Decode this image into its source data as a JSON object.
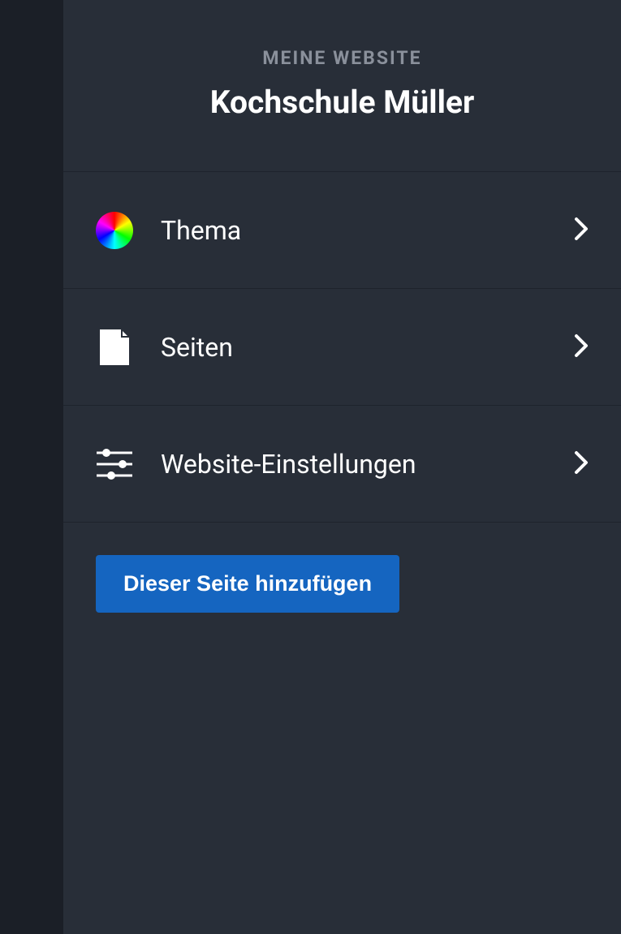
{
  "header": {
    "eyebrow": "MEINE WEBSITE",
    "title": "Kochschule Müller"
  },
  "menu": {
    "theme": {
      "label": "Thema"
    },
    "pages": {
      "label": "Seiten"
    },
    "settings": {
      "label": "Website-Einstellungen"
    }
  },
  "actions": {
    "add_to_page": "Dieser Seite hinzufügen"
  }
}
